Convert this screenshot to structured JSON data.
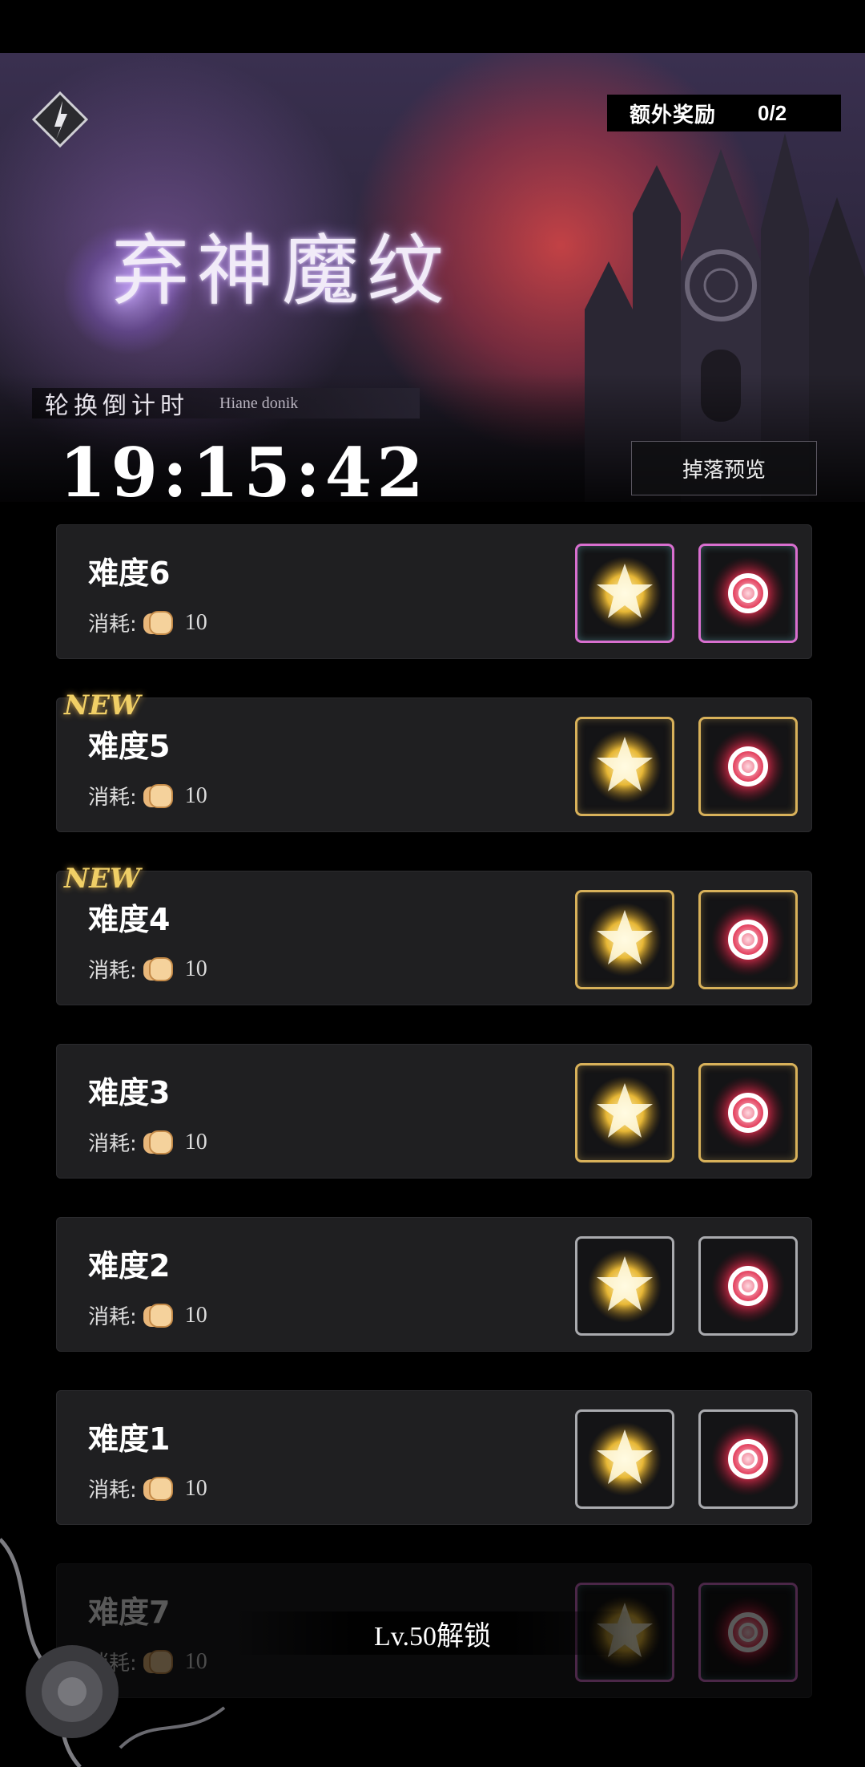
{
  "header": {
    "extra_reward_label": "额外奖励",
    "extra_reward_count": "0/2",
    "title": "弃神魔纹",
    "countdown_label": "轮换倒计时",
    "countdown_subtitle": "Hiane donik",
    "timer": "19:15:42",
    "drop_preview_label": "掉落预览"
  },
  "levels": [
    {
      "name": "难度6",
      "cost_label": "消耗:",
      "cost": "10",
      "new": "",
      "frame": "purple"
    },
    {
      "name": "难度5",
      "cost_label": "消耗:",
      "cost": "10",
      "new": "NEW",
      "frame": "gold"
    },
    {
      "name": "难度4",
      "cost_label": "消耗:",
      "cost": "10",
      "new": "NEW",
      "frame": "gold"
    },
    {
      "name": "难度3",
      "cost_label": "消耗:",
      "cost": "10",
      "new": "",
      "frame": "gold"
    },
    {
      "name": "难度2",
      "cost_label": "消耗:",
      "cost": "10",
      "new": "",
      "frame": "silver"
    },
    {
      "name": "难度1",
      "cost_label": "消耗:",
      "cost": "10",
      "new": "",
      "frame": "silver"
    },
    {
      "name": "难度7",
      "cost_label": "消耗:",
      "cost": "10",
      "new": "",
      "frame": "purple"
    }
  ],
  "lock_text": "Lv.50解锁",
  "colors": {
    "gold_frame": "#d8b15a",
    "silver_frame": "#a9aaae",
    "purple_frame": "#d86fcf",
    "new_tag": "#f0cf66"
  }
}
